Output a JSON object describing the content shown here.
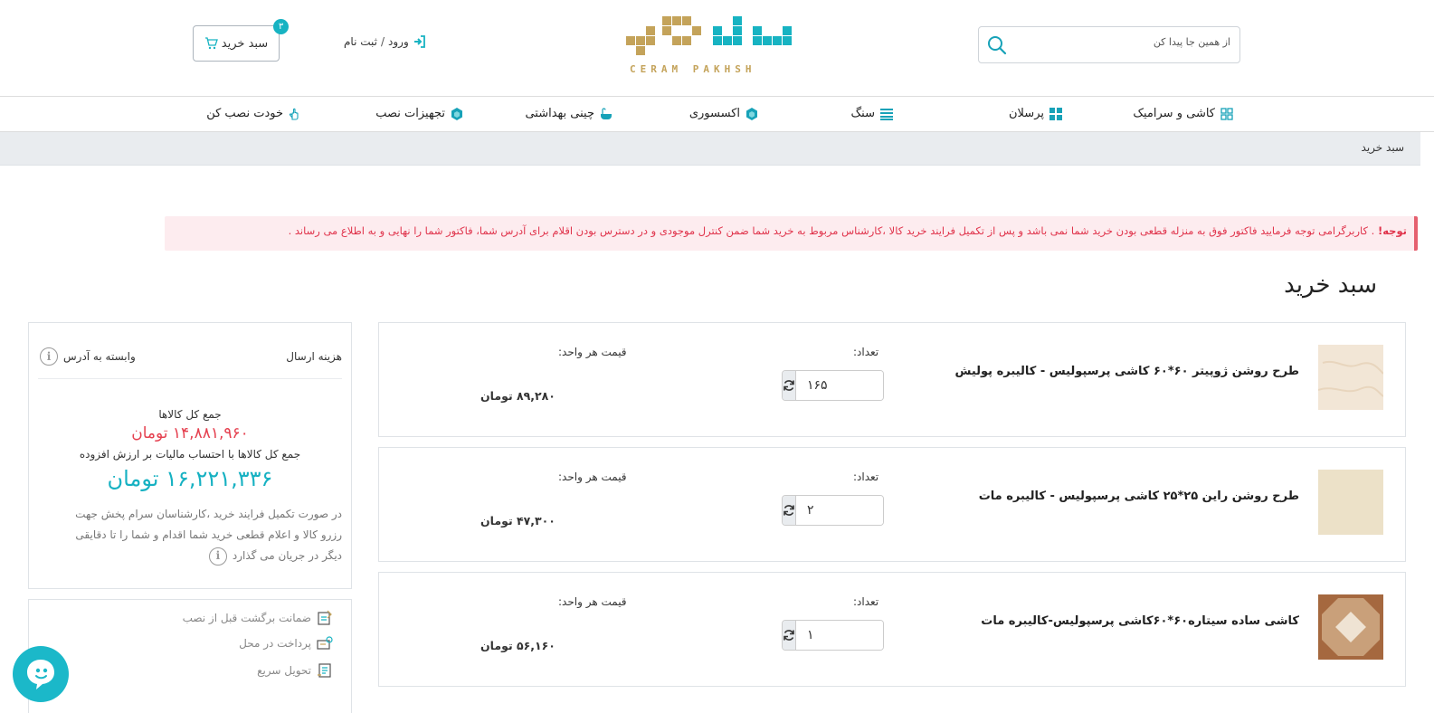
{
  "header": {
    "search_placeholder": "از همین جا پیدا کن",
    "logo_text": "CERAM PAKHSH",
    "login_label": "ورود",
    "login_separator": "/",
    "register_label": "ثبت نام",
    "cart_label": "سبد خرید",
    "cart_count": "۳"
  },
  "nav": {
    "items": [
      {
        "label": "کاشی و سرامیک",
        "icon": "tiles-grid-icon"
      },
      {
        "label": "پرسلان",
        "icon": "four-squares-icon"
      },
      {
        "label": "سنگ",
        "icon": "stone-bars-icon"
      },
      {
        "label": "اکسسوری",
        "icon": "accessory-cube-icon"
      },
      {
        "label": "چینی بهداشتی",
        "icon": "bathtub-icon"
      },
      {
        "label": "تجهیزات نصب",
        "icon": "equipment-cube-icon"
      },
      {
        "label": "خودت نصب کن",
        "icon": "hand-pointer-icon"
      }
    ]
  },
  "breadcrumb": "سبد خرید",
  "alert": {
    "prefix": "توجه!",
    "text": " . کاربرگرامی توجه فرمایید فاکتور فوق به منزله قطعی بودن خرید شما نمی باشد و پس از تکمیل فرایند خرید کالا ،کارشناس مربوط به خرید شما ضمن کنترل موجودی و در دسترس بودن اقلام برای آدرس شما، فاکتور شما را نهایی و به اطلاع می رساند ."
  },
  "page_title": "سبد خرید",
  "cart_items": [
    {
      "name": "طرح روشن ژوپیتر ۶۰*۶۰ کاشی پرسپولیس - کالیبره پولیش",
      "qty_label": "تعداد:",
      "qty": "۱۶۵",
      "unit_price_label": "قیمت هر واحد:",
      "unit_price": "۸۹,۲۸۰ تومان",
      "thumb_color": "#f2e6d6"
    },
    {
      "name": "طرح روشن راین ۲۵*۲۵ کاشی پرسپولیس - کالیبره مات",
      "qty_label": "تعداد:",
      "qty": "۲",
      "unit_price_label": "قیمت هر واحد:",
      "unit_price": "۴۷,۳۰۰ تومان",
      "thumb_color": "#ece1c8"
    },
    {
      "name": "کاشی ساده سیتاره۶۰*۶۰کاشی پرسپولیس-کالیبره مات",
      "qty_label": "تعداد:",
      "qty": "۱",
      "unit_price_label": "قیمت هر واحد:",
      "unit_price": "۵۶,۱۶۰ تومان",
      "thumb_color": "#a5683f"
    }
  ],
  "summary": {
    "shipping_label": "هزینه ارسال",
    "shipping_value": "وابسته به آدرس",
    "total_label": "جمع کل کالاها",
    "total_value": "۱۴,۸۸۱,۹۶۰ تومان",
    "total_tax_label": "جمع کل کالاها با احتساب مالیات بر ارزش افزوده",
    "total_tax_value": "۱۶,۲۲۱,۳۳۶ تومان",
    "note": "در صورت تکمیل فرایند خرید ،کارشناسان سرام پخش جهت رزرو کالا و اعلام قطعی خرید شما اقدام و شما را تا دقایقی دیگر در جریان می گذارد"
  },
  "features": [
    {
      "label": "ضمانت برگشت قبل از نصب",
      "icon": "return-guarantee-icon"
    },
    {
      "label": "پرداخت در محل",
      "icon": "pay-on-delivery-icon"
    },
    {
      "label": "تحویل سریع",
      "icon": "fast-delivery-icon"
    }
  ],
  "colors": {
    "accent": "#16b1c2",
    "brand_gold": "#c4a35a",
    "price_red": "#e5404f",
    "alert_text": "#e0334b"
  }
}
